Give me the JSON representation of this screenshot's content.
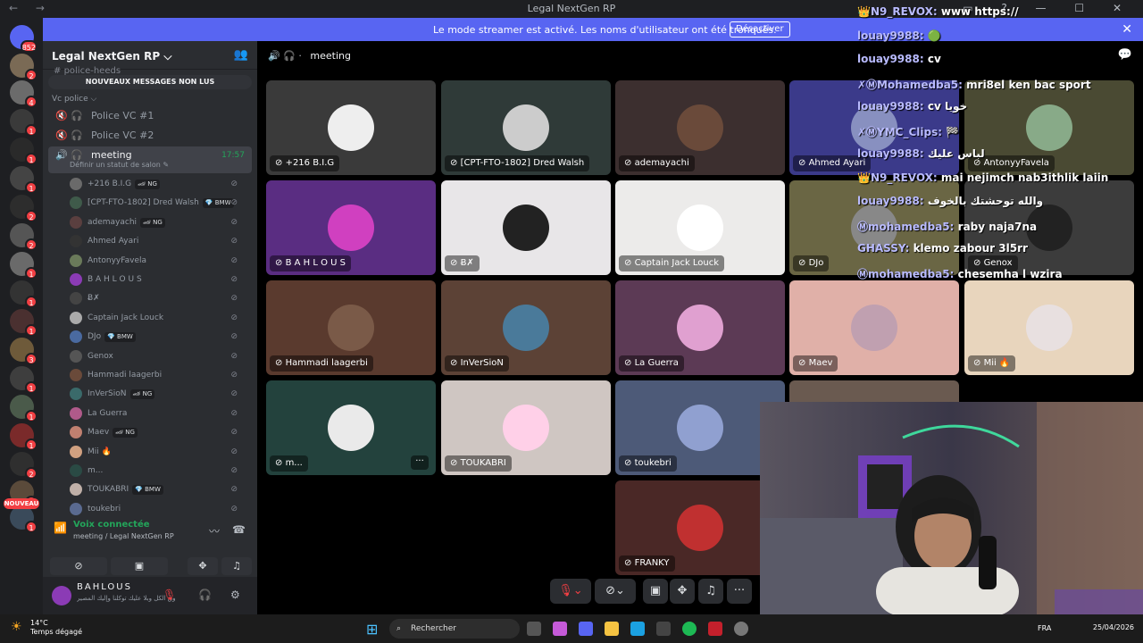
{
  "window": {
    "title": "Legal NextGen RP",
    "nav": "← →",
    "controls": "▭ ? — ☐ ✕"
  },
  "rail": {
    "home_badge": "852",
    "new_label": "NOUVEAU"
  },
  "banner": {
    "text": "Le mode streamer est activé. Les noms d'utilisateur ont été tronqués.",
    "button": "Désactiver",
    "close": "✕"
  },
  "sidebar": {
    "guild_name": "Legal NextGen RP ⌵",
    "faded_channel": "police-heeds",
    "new_messages": "NOUVEAUX MESSAGES NON LUS",
    "category": "Vc police ⌵",
    "channels": [
      {
        "name": "Police VC #1"
      },
      {
        "name": "Police VC #2"
      },
      {
        "name": "meeting",
        "time": "17:57",
        "sub": "Définir un statut de salon ✎"
      }
    ],
    "members": [
      {
        "name": "+216 B.I.G",
        "tag": "🏎 NG"
      },
      {
        "name": "[CPT-FTO-1802] Dred Walsh",
        "tag": "💎 BMW"
      },
      {
        "name": "ademayachi",
        "tag": "🏎 NG"
      },
      {
        "name": "Ahmed Ayari",
        "tag": ""
      },
      {
        "name": "AntonyyFavela",
        "tag": ""
      },
      {
        "name": "B A H L O U S",
        "tag": ""
      },
      {
        "name": "Ƀ✗",
        "tag": ""
      },
      {
        "name": "Captain Jack Louck",
        "tag": ""
      },
      {
        "name": "DJo",
        "tag": "💎 BMW"
      },
      {
        "name": "Genox",
        "tag": ""
      },
      {
        "name": "Hammadi laagerbi",
        "tag": ""
      },
      {
        "name": "InVerSioN",
        "tag": "🏎 NG"
      },
      {
        "name": "La Guerra",
        "tag": ""
      },
      {
        "name": "Maev",
        "tag": "🏎 NG"
      },
      {
        "name": "Mii 🔥",
        "tag": ""
      },
      {
        "name": "m...",
        "tag": ""
      },
      {
        "name": "TOUKABRI",
        "tag": "💎 BMW"
      },
      {
        "name": "toukebri",
        "tag": ""
      }
    ],
    "voice": {
      "status": "Voix connectée",
      "location": "meeting / Legal NextGen RP"
    },
    "user": {
      "name": "BAHLOUS",
      "status": "ربنا فوق الكل وبلا عليك توكلنا وإليك المصير"
    }
  },
  "main": {
    "channel_title": "meeting",
    "tiles": [
      {
        "name": "+216 B.I.G",
        "bg": "#3a3a3a"
      },
      {
        "name": "[CPT-FTO-1802] Dred Walsh",
        "bg": "#2f3a38"
      },
      {
        "name": "ademayachi",
        "bg": "#3c2f2f"
      },
      {
        "name": "Ahmed Ayari",
        "bg": "#3b3a8a"
      },
      {
        "name": "AntonyyFavela",
        "bg": "#4a4a33"
      },
      {
        "name": "B A H L O U S",
        "bg": "#5a2d82"
      },
      {
        "name": "Ƀ✗",
        "bg": "#e8e6e8"
      },
      {
        "name": "Captain Jack Louck",
        "bg": "#ecebea"
      },
      {
        "name": "DJo",
        "bg": "#6a6644"
      },
      {
        "name": "Genox",
        "bg": "#3c3c3c"
      },
      {
        "name": "Hammadi laagerbi",
        "bg": "#5a3a2e"
      },
      {
        "name": "InVerSioN",
        "bg": "#5c4236"
      },
      {
        "name": "La Guerra",
        "bg": "#5c3a55"
      },
      {
        "name": "Maev",
        "bg": "#e0b0a8"
      },
      {
        "name": "Mii 🔥",
        "bg": "#e8d5bd"
      },
      {
        "name": "m...",
        "bg": "#23423d"
      },
      {
        "name": "TOUKABRI",
        "bg": "#cfc6c2"
      },
      {
        "name": "toukebri",
        "bg": "#4d5a78"
      },
      {
        "name": "FRANKY",
        "bg": "#4a2826"
      }
    ],
    "more": "···"
  },
  "chat": [
    {
      "user": "👑N9_REVOX:",
      "msg": "www https://"
    },
    {
      "user": "louay9988:",
      "msg": "🟢"
    },
    {
      "user": "louay9988:",
      "msg": "cv"
    },
    {
      "user": "✗ⓂMohamedba5:",
      "msg": "mri8el ken bac sport"
    },
    {
      "user": "louay9988:",
      "msg": "cv خويا"
    },
    {
      "user": "✗ⓂYMC_Clips:",
      "msg": "🏁"
    },
    {
      "user": "louay9988:",
      "msg": "لباس عليك"
    },
    {
      "user": "👑N9_REVOX:",
      "msg": "mai nejimch nab3ithlik laiin"
    },
    {
      "user": "louay9988:",
      "msg": "والله توحشتك بالخوف"
    },
    {
      "user": "Ⓜmohamedba5:",
      "msg": "raby naja7na"
    },
    {
      "user": "GHASSY:",
      "msg": "klemo zabour 3l5rr"
    },
    {
      "user": "Ⓜmohamedba5:",
      "msg": "chesemha l wzira"
    }
  ],
  "taskbar": {
    "temp": "14°C",
    "weather": "Temps dégagé",
    "search": "Rechercher",
    "lang": "FRA",
    "date": "25/04/2026"
  }
}
